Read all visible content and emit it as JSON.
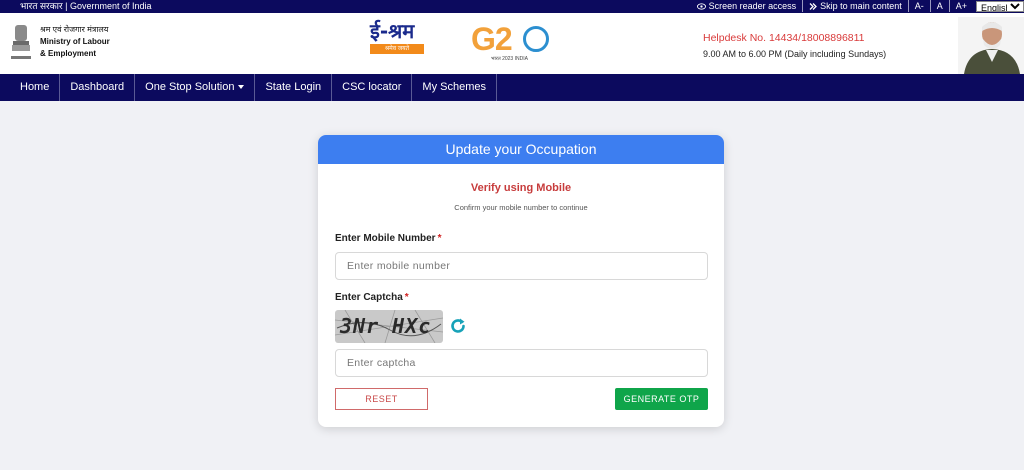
{
  "topbar": {
    "gov_text": "भारत सरकार | Government of India",
    "screen_reader": "Screen reader access",
    "skip_main": "Skip to main content",
    "font_decrease": "A-",
    "font_normal": "A",
    "font_increase": "A+",
    "language": "English"
  },
  "header": {
    "ministry_hi": "श्रम एवं रोजगार मंत्रालय",
    "ministry_en_1": "Ministry of Labour",
    "ministry_en_2": "& Employment",
    "eshram_word": "ई-श्रम",
    "eshram_tag": "श्रमेव जयते",
    "g20_text": "G2",
    "g20_sub": "भारत 2023 INDIA",
    "helpdesk": "Helpdesk No. 14434/18008896811",
    "hours": "9.00 AM to 6.00 PM (Daily including Sundays)"
  },
  "nav": {
    "items": [
      "Home",
      "Dashboard",
      "One Stop Solution",
      "State Login",
      "CSC locator",
      "My Schemes"
    ]
  },
  "form": {
    "title": "Update your Occupation",
    "verify_heading": "Verify using Mobile",
    "verify_sub": "Confirm your mobile number to continue",
    "mobile_label": "Enter Mobile Number",
    "mobile_placeholder": "Enter mobile number",
    "captcha_label": "Enter Captcha",
    "captcha_text": "3Nr HXc",
    "captcha_placeholder": "Enter captcha",
    "required_mark": "*",
    "reset_label": "RESET",
    "otp_label": "GENERATE OTP"
  },
  "colors": {
    "navy": "#0c0a5e",
    "card_header": "#3d7ef0",
    "verify_red": "#c73c3c",
    "otp_green": "#0fa54a",
    "refresh_teal": "#17a2b8"
  },
  "icons": {
    "screen_reader": "eye-icon",
    "skip": "double-chevron-right-icon",
    "dropdown": "caret-down-icon",
    "captcha_refresh": "refresh-icon"
  }
}
